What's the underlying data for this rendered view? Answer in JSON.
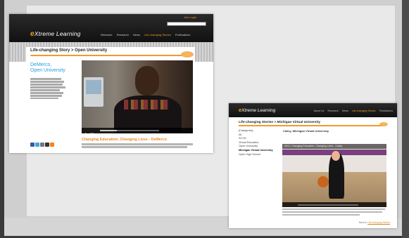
{
  "site1": {
    "toplinks": "Join  Login",
    "logo_prefix": "e",
    "logo_rest": "Xtreme Learning",
    "nav": [
      {
        "label": "Welcome",
        "active": false
      },
      {
        "label": "Research",
        "active": false
      },
      {
        "label": "News",
        "active": false
      },
      {
        "label": "Life-changing Stories",
        "active": true
      },
      {
        "label": "Publications",
        "active": false
      }
    ],
    "breadcrumb": "Life-changing Story > Open University",
    "person_name_line1": "DeMerco,",
    "person_name_line2": "Open University",
    "headline": "Changing Education. Changing Lives - DeMerco",
    "social_colors": [
      "#3b5998",
      "#39a9e0",
      "#777777",
      "#333333",
      "#f58220"
    ]
  },
  "site2": {
    "logo_prefix": "e",
    "logo_rest": "Xtreme Learning",
    "nav": [
      {
        "label": "About Us",
        "active": false
      },
      {
        "label": "Research",
        "active": false
      },
      {
        "label": "News",
        "active": false
      },
      {
        "label": "Life-changing Stories",
        "active": true
      },
      {
        "label": "Publications",
        "active": false
      }
    ],
    "breadcrumb": "Life-changing Stories > Michigan Virtual University",
    "categories": [
      {
        "label": "[Categories]",
        "selected": false
      },
      {
        "label": "All",
        "selected": false
      },
      {
        "label": "SCVH",
        "selected": false
      },
      {
        "label": "Virtual Education",
        "selected": false
      },
      {
        "label": "Open University",
        "selected": false
      },
      {
        "label": "Michigan Virtual University",
        "selected": true
      },
      {
        "label": "Open High School",
        "selected": false
      }
    ],
    "story_title": "Cailey, Michigan Virtual University",
    "video_title": "MVU: Changing Education. Changing Lives - Cailey",
    "back_prefix": "Back to",
    "back_link": "Life-changing Stories"
  }
}
